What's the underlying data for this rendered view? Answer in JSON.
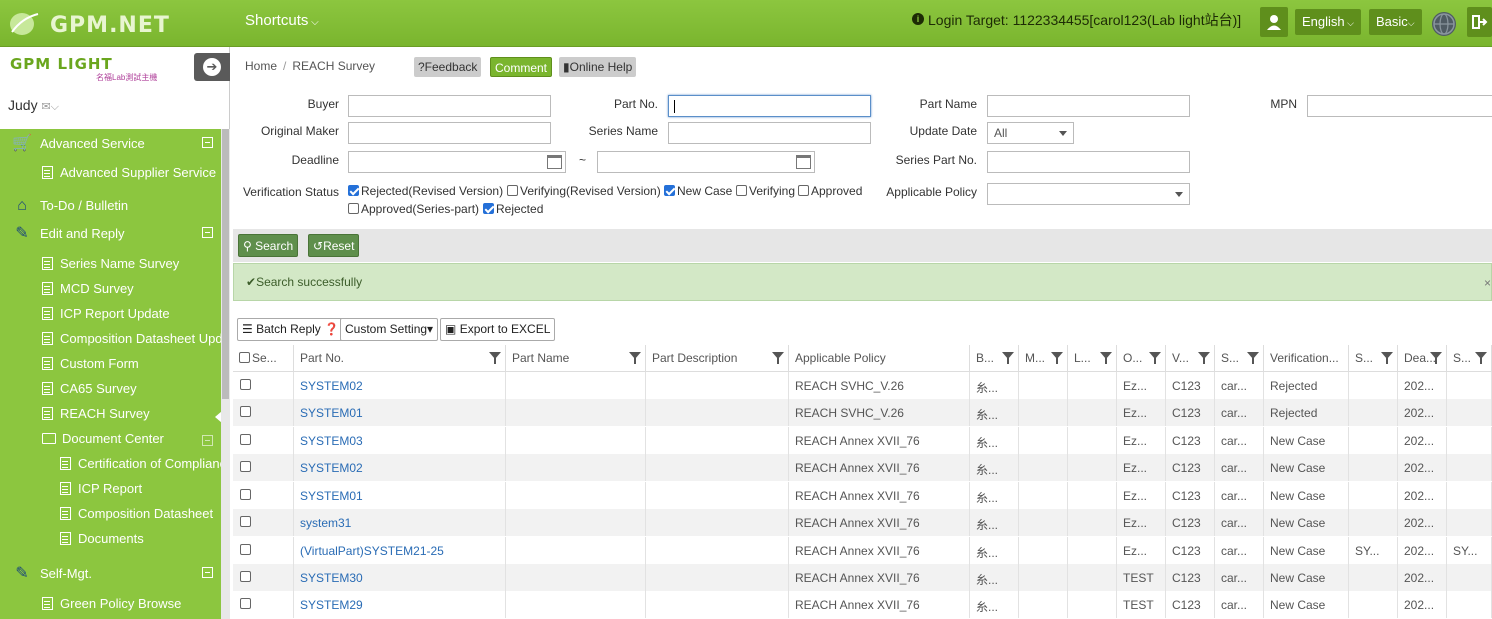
{
  "topbar": {
    "logo_text": "GPM.NET",
    "shortcuts": "Shortcuts",
    "login_target": "Login Target: 1122334455[carol123(Lab light站台)]",
    "language": "English",
    "mode": "Basic"
  },
  "sidebar": {
    "logo_main": "GPM LIGHT",
    "logo_sub": "名福Lab測試主機",
    "user": "Judy",
    "items": [
      {
        "label": "Advanced Service"
      },
      {
        "label": "Advanced Supplier Service"
      },
      {
        "label": "To-Do / Bulletin"
      },
      {
        "label": "Edit and Reply"
      },
      {
        "label": "Series Name Survey"
      },
      {
        "label": "MCD Survey"
      },
      {
        "label": "ICP Report Update"
      },
      {
        "label": "Composition Datasheet Update"
      },
      {
        "label": "Custom Form"
      },
      {
        "label": "CA65 Survey"
      },
      {
        "label": "REACH Survey"
      },
      {
        "label": "Document Center"
      },
      {
        "label": "Certification of Compliance"
      },
      {
        "label": "ICP Report"
      },
      {
        "label": "Composition Datasheet"
      },
      {
        "label": "Documents"
      },
      {
        "label": "Self-Mgt."
      },
      {
        "label": "Green Policy Browse"
      }
    ]
  },
  "breadcrumb": {
    "home": "Home",
    "current": "REACH Survey"
  },
  "header_buttons": {
    "feedback": "?Feedback",
    "comment": "Comment",
    "help": "Online Help"
  },
  "form": {
    "buyer": "Buyer",
    "part_no": "Part No.",
    "part_name": "Part Name",
    "mpn": "MPN",
    "original_maker": "Original Maker",
    "series_name": "Series Name",
    "update_date": "Update Date",
    "update_date_value": "All",
    "deadline": "Deadline",
    "tilde": "~",
    "series_part_no": "Series Part No.",
    "verification_status": "Verification Status",
    "applicable_policy": "Applicable Policy",
    "status_options": [
      {
        "label": "Rejected(Revised Version)",
        "checked": true
      },
      {
        "label": "Verifying(Revised Version)",
        "checked": false
      },
      {
        "label": "New Case",
        "checked": true
      },
      {
        "label": "Verifying",
        "checked": false
      },
      {
        "label": "Approved",
        "checked": false
      },
      {
        "label": "Approved(Series-part)",
        "checked": false
      },
      {
        "label": "Rejected",
        "checked": true
      }
    ]
  },
  "actions": {
    "search": "Search",
    "reset": "Reset"
  },
  "message": {
    "text": "Search successfully",
    "close": "×"
  },
  "table_tools": {
    "batch": "Batch Reply",
    "custom": "Custom Setting",
    "export": "Export to EXCEL"
  },
  "table": {
    "headers": [
      "Se...",
      "Part No.",
      "Part Name",
      "Part Description",
      "Applicable Policy",
      "B...",
      "M...",
      "L...",
      "O...",
      "V...",
      "S...",
      "Verification...",
      "S...",
      "Dea...",
      "S..."
    ],
    "rows": [
      [
        "SYSTEM02",
        "",
        "",
        "REACH SVHC_V.26",
        "糸...",
        "",
        "",
        "Ez...",
        "C123",
        "car...",
        "Rejected",
        "",
        "202...",
        ""
      ],
      [
        "SYSTEM01",
        "",
        "",
        "REACH SVHC_V.26",
        "糸...",
        "",
        "",
        "Ez...",
        "C123",
        "car...",
        "Rejected",
        "",
        "202...",
        ""
      ],
      [
        "SYSTEM03",
        "",
        "",
        "REACH Annex XVII_76",
        "糸...",
        "",
        "",
        "Ez...",
        "C123",
        "car...",
        "New Case",
        "",
        "202...",
        ""
      ],
      [
        "SYSTEM02",
        "",
        "",
        "REACH Annex XVII_76",
        "糸...",
        "",
        "",
        "Ez...",
        "C123",
        "car...",
        "New Case",
        "",
        "202...",
        ""
      ],
      [
        "SYSTEM01",
        "",
        "",
        "REACH Annex XVII_76",
        "糸...",
        "",
        "",
        "Ez...",
        "C123",
        "car...",
        "New Case",
        "",
        "202...",
        ""
      ],
      [
        "system31",
        "",
        "",
        "REACH Annex XVII_76",
        "糸...",
        "",
        "",
        "Ez...",
        "C123",
        "car...",
        "New Case",
        "",
        "202...",
        ""
      ],
      [
        "(VirtualPart)SYSTEM21-25",
        "",
        "",
        "REACH Annex XVII_76",
        "糸...",
        "",
        "",
        "Ez...",
        "C123",
        "car...",
        "New Case",
        "SY...",
        "202...",
        "SY..."
      ],
      [
        "SYSTEM30",
        "",
        "",
        "REACH Annex XVII_76",
        "糸...",
        "",
        "",
        "TEST",
        "C123",
        "car...",
        "New Case",
        "",
        "202...",
        ""
      ],
      [
        "SYSTEM29",
        "",
        "",
        "REACH Annex XVII_76",
        "糸...",
        "",
        "",
        "TEST",
        "C123",
        "car...",
        "New Case",
        "",
        "202...",
        ""
      ]
    ]
  },
  "colors": {
    "brand_green": "#8cc63f",
    "dark_green": "#5f8f1c",
    "link": "#2a6cb5"
  }
}
